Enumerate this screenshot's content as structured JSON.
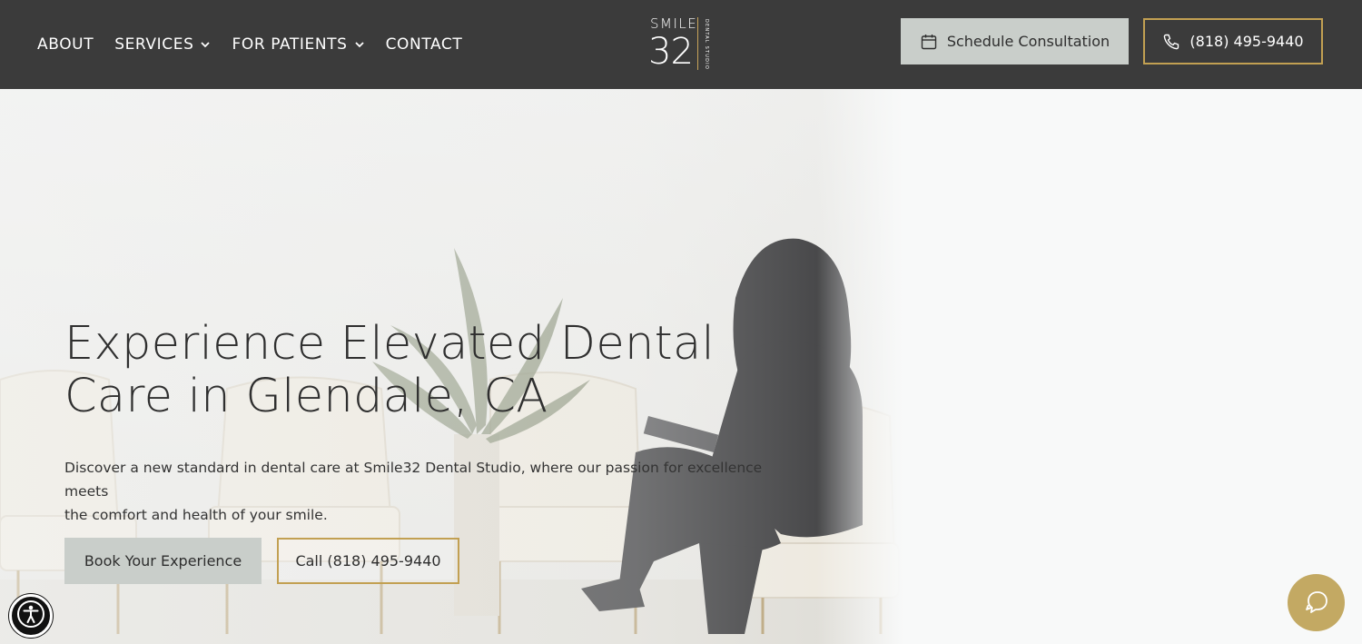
{
  "nav": {
    "items": [
      {
        "label": "ABOUT",
        "has_dropdown": false
      },
      {
        "label": "SERVICES",
        "has_dropdown": true
      },
      {
        "label": "FOR PATIENTS",
        "has_dropdown": true
      },
      {
        "label": "CONTACT",
        "has_dropdown": false
      }
    ]
  },
  "logo": {
    "word": "SMILE",
    "number": "32",
    "vertical": "DENTAL STUDIO"
  },
  "header": {
    "schedule_label": "Schedule Consultation",
    "phone_label": "(818) 495-9440",
    "schedule_icon": "calendar-icon",
    "phone_icon": "phone-icon"
  },
  "hero": {
    "title_line1": "Experience Elevated Dental",
    "title_line2": "Care in Glendale, CA",
    "text_line1": "Discover a new standard in dental care at Smile32 Dental Studio, where our passion for excellence meets",
    "text_line2": "the comfort and health of your smile.",
    "book_label": "Book Your Experience",
    "call_label": "Call (818) 495-9440"
  },
  "widgets": {
    "accessibility_icon": "accessibility-icon",
    "chat_icon": "chat-icon"
  },
  "colors": {
    "header_bg": "#3b3b3b",
    "accent_gold": "#c2a052",
    "button_gray": "#c9ceca",
    "chat_gold": "#c3a963"
  }
}
